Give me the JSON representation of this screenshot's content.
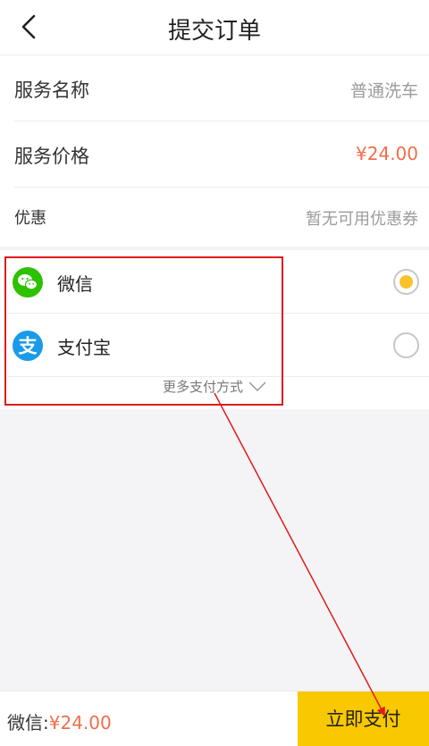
{
  "header": {
    "title": "提交订单"
  },
  "order": {
    "service_name_label": "服务名称",
    "service_name_value": "普通洗车",
    "service_price_label": "服务价格",
    "service_price_value": "¥24.00",
    "discount_label": "优惠",
    "discount_value": "暂无可用优惠券"
  },
  "payment": {
    "wechat_label": "微信",
    "alipay_label": "支付宝",
    "more_label": "更多支付方式",
    "selected": "wechat",
    "accent_color": "#f8c22b"
  },
  "footer": {
    "method_label": "微信:",
    "amount": "¥24.00",
    "pay_button": "立即支付"
  },
  "icons": {
    "back": "chevron-left-icon",
    "wechat": "wechat-icon",
    "alipay": "alipay-icon",
    "more": "chevron-down-icon"
  }
}
